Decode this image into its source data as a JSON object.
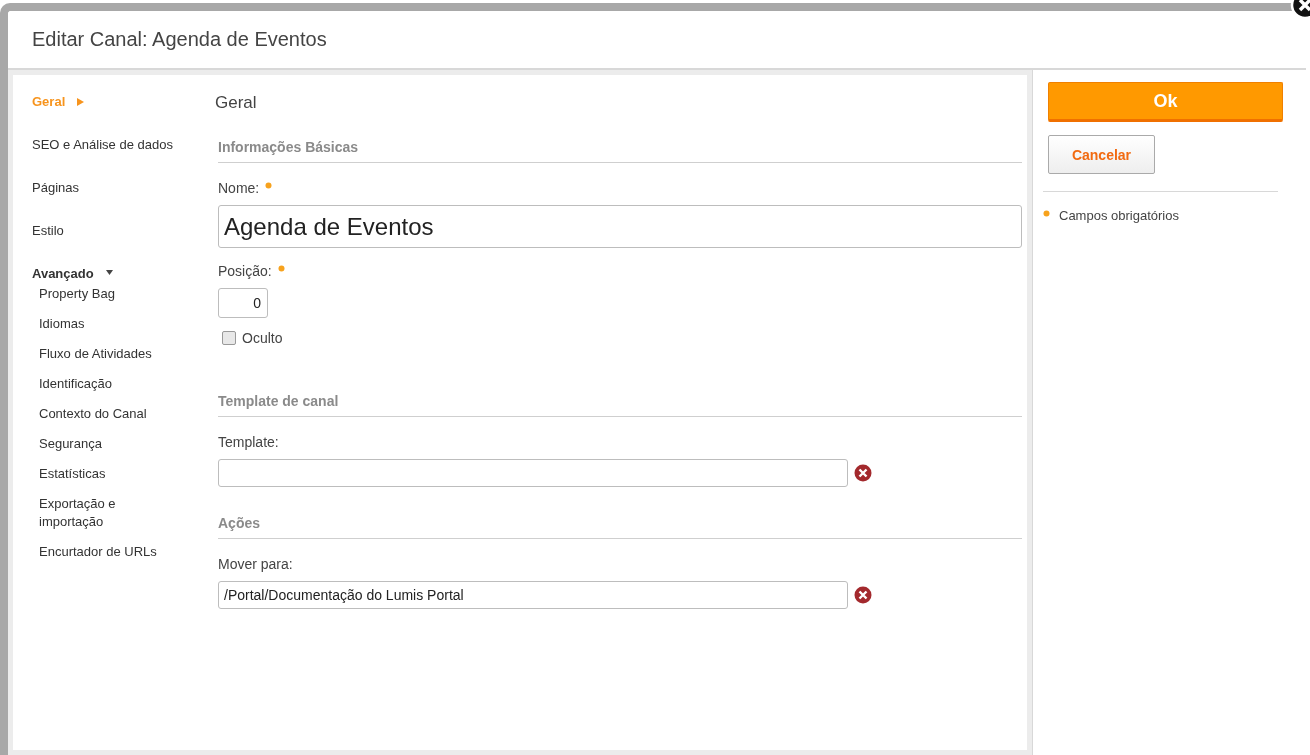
{
  "dialog": {
    "title": "Editar Canal: Agenda de Eventos"
  },
  "nav": [
    {
      "label": "Geral",
      "selected": true
    },
    {
      "label": "SEO e Análise de dados",
      "selected": false
    },
    {
      "label": "Páginas",
      "selected": false
    },
    {
      "label": "Estilo",
      "selected": false
    },
    {
      "label": "Avançado",
      "selected": false,
      "expanded": true,
      "children": [
        {
          "label": "Property Bag",
          "selected": false
        },
        {
          "label": "Idiomas",
          "selected": false
        },
        {
          "label": "Fluxo de Atividades",
          "selected": false
        },
        {
          "label": "Identificação",
          "selected": false
        },
        {
          "label": "Contexto do Canal",
          "selected": false
        },
        {
          "label": "Segurança",
          "selected": false
        },
        {
          "label": "Estatísticas",
          "selected": false
        },
        {
          "label": "Exportação e importação",
          "selected": false
        },
        {
          "label": "Encurtador de URLs",
          "selected": false
        }
      ]
    }
  ],
  "page_heading": "Geral",
  "sections": [
    {
      "title": "Informações Básicas",
      "fields": [
        {
          "kind": "large-text",
          "label": "Nome:",
          "required": true,
          "value": "Agenda de Eventos"
        },
        {
          "kind": "number",
          "label": "Posição:",
          "required": true,
          "value": "0"
        },
        {
          "kind": "checkbox",
          "label": "Oculto",
          "checked": false
        }
      ]
    },
    {
      "title": "Template de canal",
      "fields": [
        {
          "kind": "lookup",
          "label": "Template:",
          "required": false
        }
      ]
    },
    {
      "title": "Ações",
      "fields": [
        {
          "kind": "lookup",
          "label": "Mover para:",
          "required": false,
          "value": "/Portal/Documentação do Lumis Portal"
        }
      ]
    }
  ],
  "buttons": [
    {
      "label": "Ok",
      "kind": "primary"
    },
    {
      "label": "Cancelar",
      "kind": "secondary"
    }
  ],
  "legend": "Campos obrigatórios"
}
